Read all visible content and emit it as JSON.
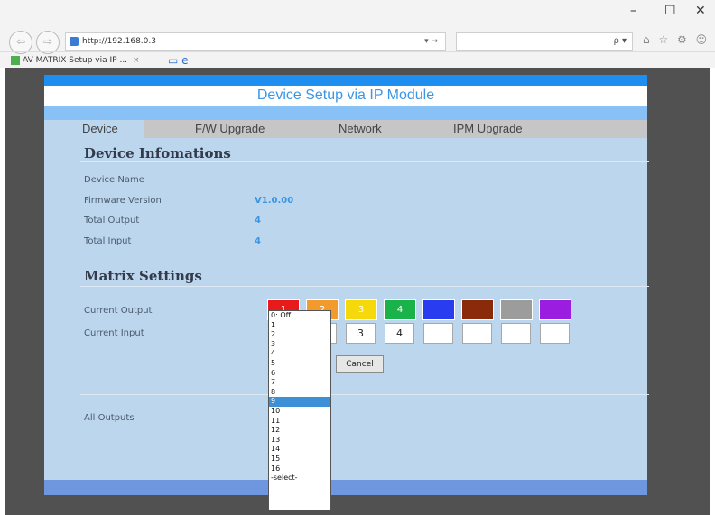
{
  "browser": {
    "minimize": "–",
    "maximize": "☐",
    "close": "✕",
    "back": "⇦",
    "forward": "⇨",
    "url": "http://192.168.0.3",
    "go": "▾ →",
    "search_icon": "ρ ▾",
    "toolbar_icons": "⌂ ☆ ⚙ ☺",
    "tab_title": "AV MATRIX Setup via IP ...",
    "tab_close": "×"
  },
  "page": {
    "title": "Device Setup via IP Module",
    "tabs": [
      {
        "label": "Device"
      },
      {
        "label": "F/W Upgrade"
      },
      {
        "label": "Network"
      },
      {
        "label": "IPM Upgrade"
      }
    ],
    "device_info": {
      "heading": "Device Infomations",
      "rows": [
        {
          "label": "Device Name",
          "value": ""
        },
        {
          "label": "Firmware Version",
          "value": "V1.0.00"
        },
        {
          "label": "Total Output",
          "value": "4"
        },
        {
          "label": "Total Input",
          "value": "4"
        }
      ]
    },
    "matrix": {
      "heading": "Matrix Settings",
      "current_output_label": "Current Output",
      "current_input_label": "Current Input",
      "outputs": [
        {
          "label": "1",
          "color": "#e81a1a"
        },
        {
          "label": "2",
          "color": "#f39a2d"
        },
        {
          "label": "3",
          "color": "#f5d90a"
        },
        {
          "label": "4",
          "color": "#19b34a"
        },
        {
          "label": "",
          "color": "#2a3cf0"
        },
        {
          "label": "",
          "color": "#8b2a0a"
        },
        {
          "label": "",
          "color": "#9c9c9c"
        },
        {
          "label": "",
          "color": "#9b1ee0"
        }
      ],
      "inputs": [
        "",
        "",
        "3",
        "4",
        "",
        "",
        "",
        ""
      ],
      "cancel_label": "Cancel",
      "all_outputs_label": "All Outputs"
    },
    "dropdown": {
      "options": [
        "0: Off",
        "1",
        "2",
        "3",
        "4",
        "5",
        "6",
        "7",
        "8",
        "9",
        "10",
        "11",
        "12",
        "13",
        "14",
        "15",
        "16",
        "-select-"
      ],
      "selected_index": 9
    }
  }
}
